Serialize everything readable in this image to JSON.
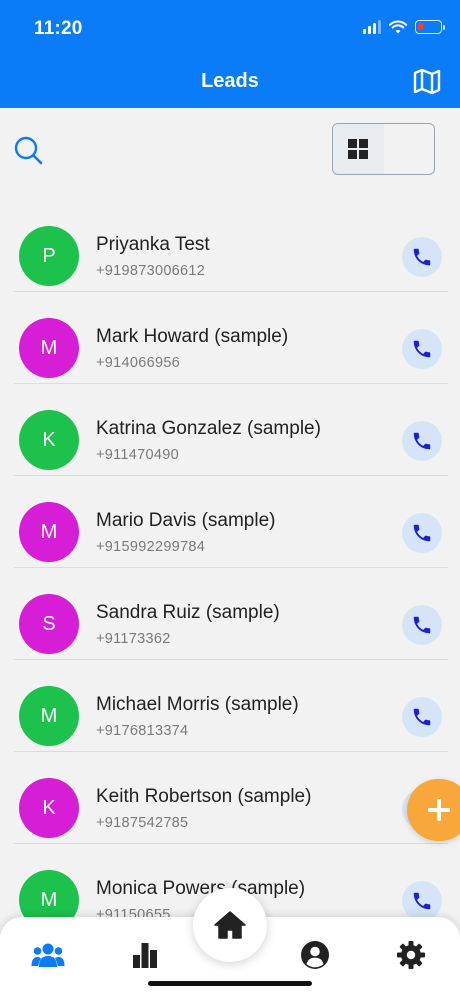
{
  "status_bar": {
    "time": "11:20"
  },
  "header": {
    "title": "Leads"
  },
  "colors": {
    "primary": "#0a7cf8",
    "avatar_green": "#1cc24b",
    "avatar_magenta": "#d51ed5",
    "fab": "#f8a83b",
    "call_icon": "#1d1fd0"
  },
  "toolbar": {
    "view_mode": "list"
  },
  "leads": [
    {
      "initial": "P",
      "name": "Priyanka Test",
      "phone": "+919873006612",
      "color": "#1cc24b"
    },
    {
      "initial": "M",
      "name": "Mark Howard (sample)",
      "phone": "+914066956",
      "color": "#d51ed5"
    },
    {
      "initial": "K",
      "name": "Katrina Gonzalez (sample)",
      "phone": "+911470490",
      "color": "#1cc24b"
    },
    {
      "initial": "M",
      "name": "Mario Davis (sample)",
      "phone": "+915992299784",
      "color": "#d51ed5"
    },
    {
      "initial": "S",
      "name": "Sandra Ruiz (sample)",
      "phone": "+91173362",
      "color": "#d51ed5"
    },
    {
      "initial": "M",
      "name": "Michael Morris (sample)",
      "phone": "+9176813374",
      "color": "#1cc24b"
    },
    {
      "initial": "K",
      "name": "Keith Robertson (sample)",
      "phone": "+9187542785",
      "color": "#d51ed5"
    },
    {
      "initial": "M",
      "name": "Monica Powers (sample)",
      "phone": "+91150655",
      "color": "#1cc24b"
    }
  ],
  "bottom_nav": {
    "items": [
      {
        "icon": "people-icon",
        "active": true
      },
      {
        "icon": "bar-chart-icon",
        "active": false
      },
      {
        "icon": "home-icon",
        "active": false
      },
      {
        "icon": "account-icon",
        "active": false
      },
      {
        "icon": "gear-icon",
        "active": false
      }
    ]
  }
}
